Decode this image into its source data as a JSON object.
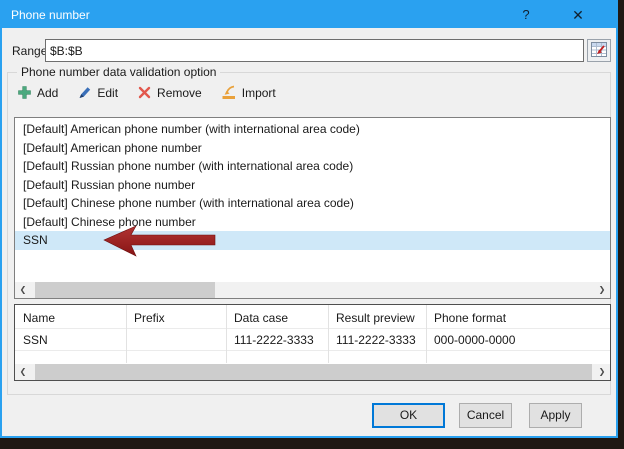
{
  "window": {
    "title": "Phone number",
    "help_glyph": "?",
    "close_glyph": "✕"
  },
  "range": {
    "label": "Range:",
    "value": "$B:$B"
  },
  "group": {
    "label": "Phone number data validation option"
  },
  "toolbar": {
    "add": "Add",
    "edit": "Edit",
    "remove": "Remove",
    "import": "Import"
  },
  "listbox": {
    "items": [
      "[Default] American phone number (with international area code)",
      "[Default] American phone number",
      "[Default] Russian phone number (with international area code)",
      "[Default] Russian phone number",
      "[Default] Chinese phone number (with international area code)",
      "[Default] Chinese phone number",
      "SSN"
    ],
    "selected_index": 6
  },
  "scrollbar": {
    "left_glyph": "❮",
    "right_glyph": "❯"
  },
  "table": {
    "headers": [
      "Name",
      "Prefix",
      "Data case",
      "Result preview",
      "Phone format"
    ],
    "rows": [
      [
        "SSN",
        "",
        "111-2222-3333",
        "111-2222-3333",
        "000-0000-0000"
      ]
    ]
  },
  "buttons": {
    "ok": "OK",
    "cancel": "Cancel",
    "apply": "Apply"
  },
  "icons": {
    "add": "plus-icon",
    "edit": "pencil-icon",
    "remove": "x-icon",
    "import": "import-tray-icon",
    "range": "range-picker-grid-icon",
    "annotation": "red-arrow-left"
  },
  "colors": {
    "titlebar": "#2AA1F0",
    "dialog_bg": "#F0F0F0",
    "selection": "#CFE8F8",
    "annotation_arrow": "#9E2121",
    "add_icon": "#4BA97E",
    "edit_icon": "#3A6FB8",
    "remove_icon": "#E2574C",
    "import_icon": "#E9A13B",
    "ok_focus_border": "#0078D7"
  }
}
